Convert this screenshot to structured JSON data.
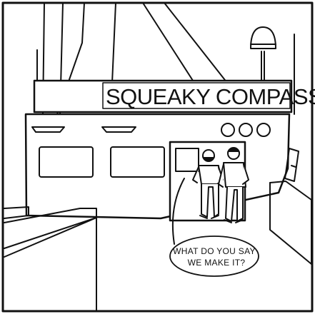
{
  "sign": {
    "text": "SQUEAKY COMPASS"
  },
  "bubble": {
    "line1": "WHAT DO YOU SAY",
    "line2": "WE MAKE IT?"
  },
  "colors": {
    "ink": "#111111",
    "paper": "#ffffff"
  }
}
